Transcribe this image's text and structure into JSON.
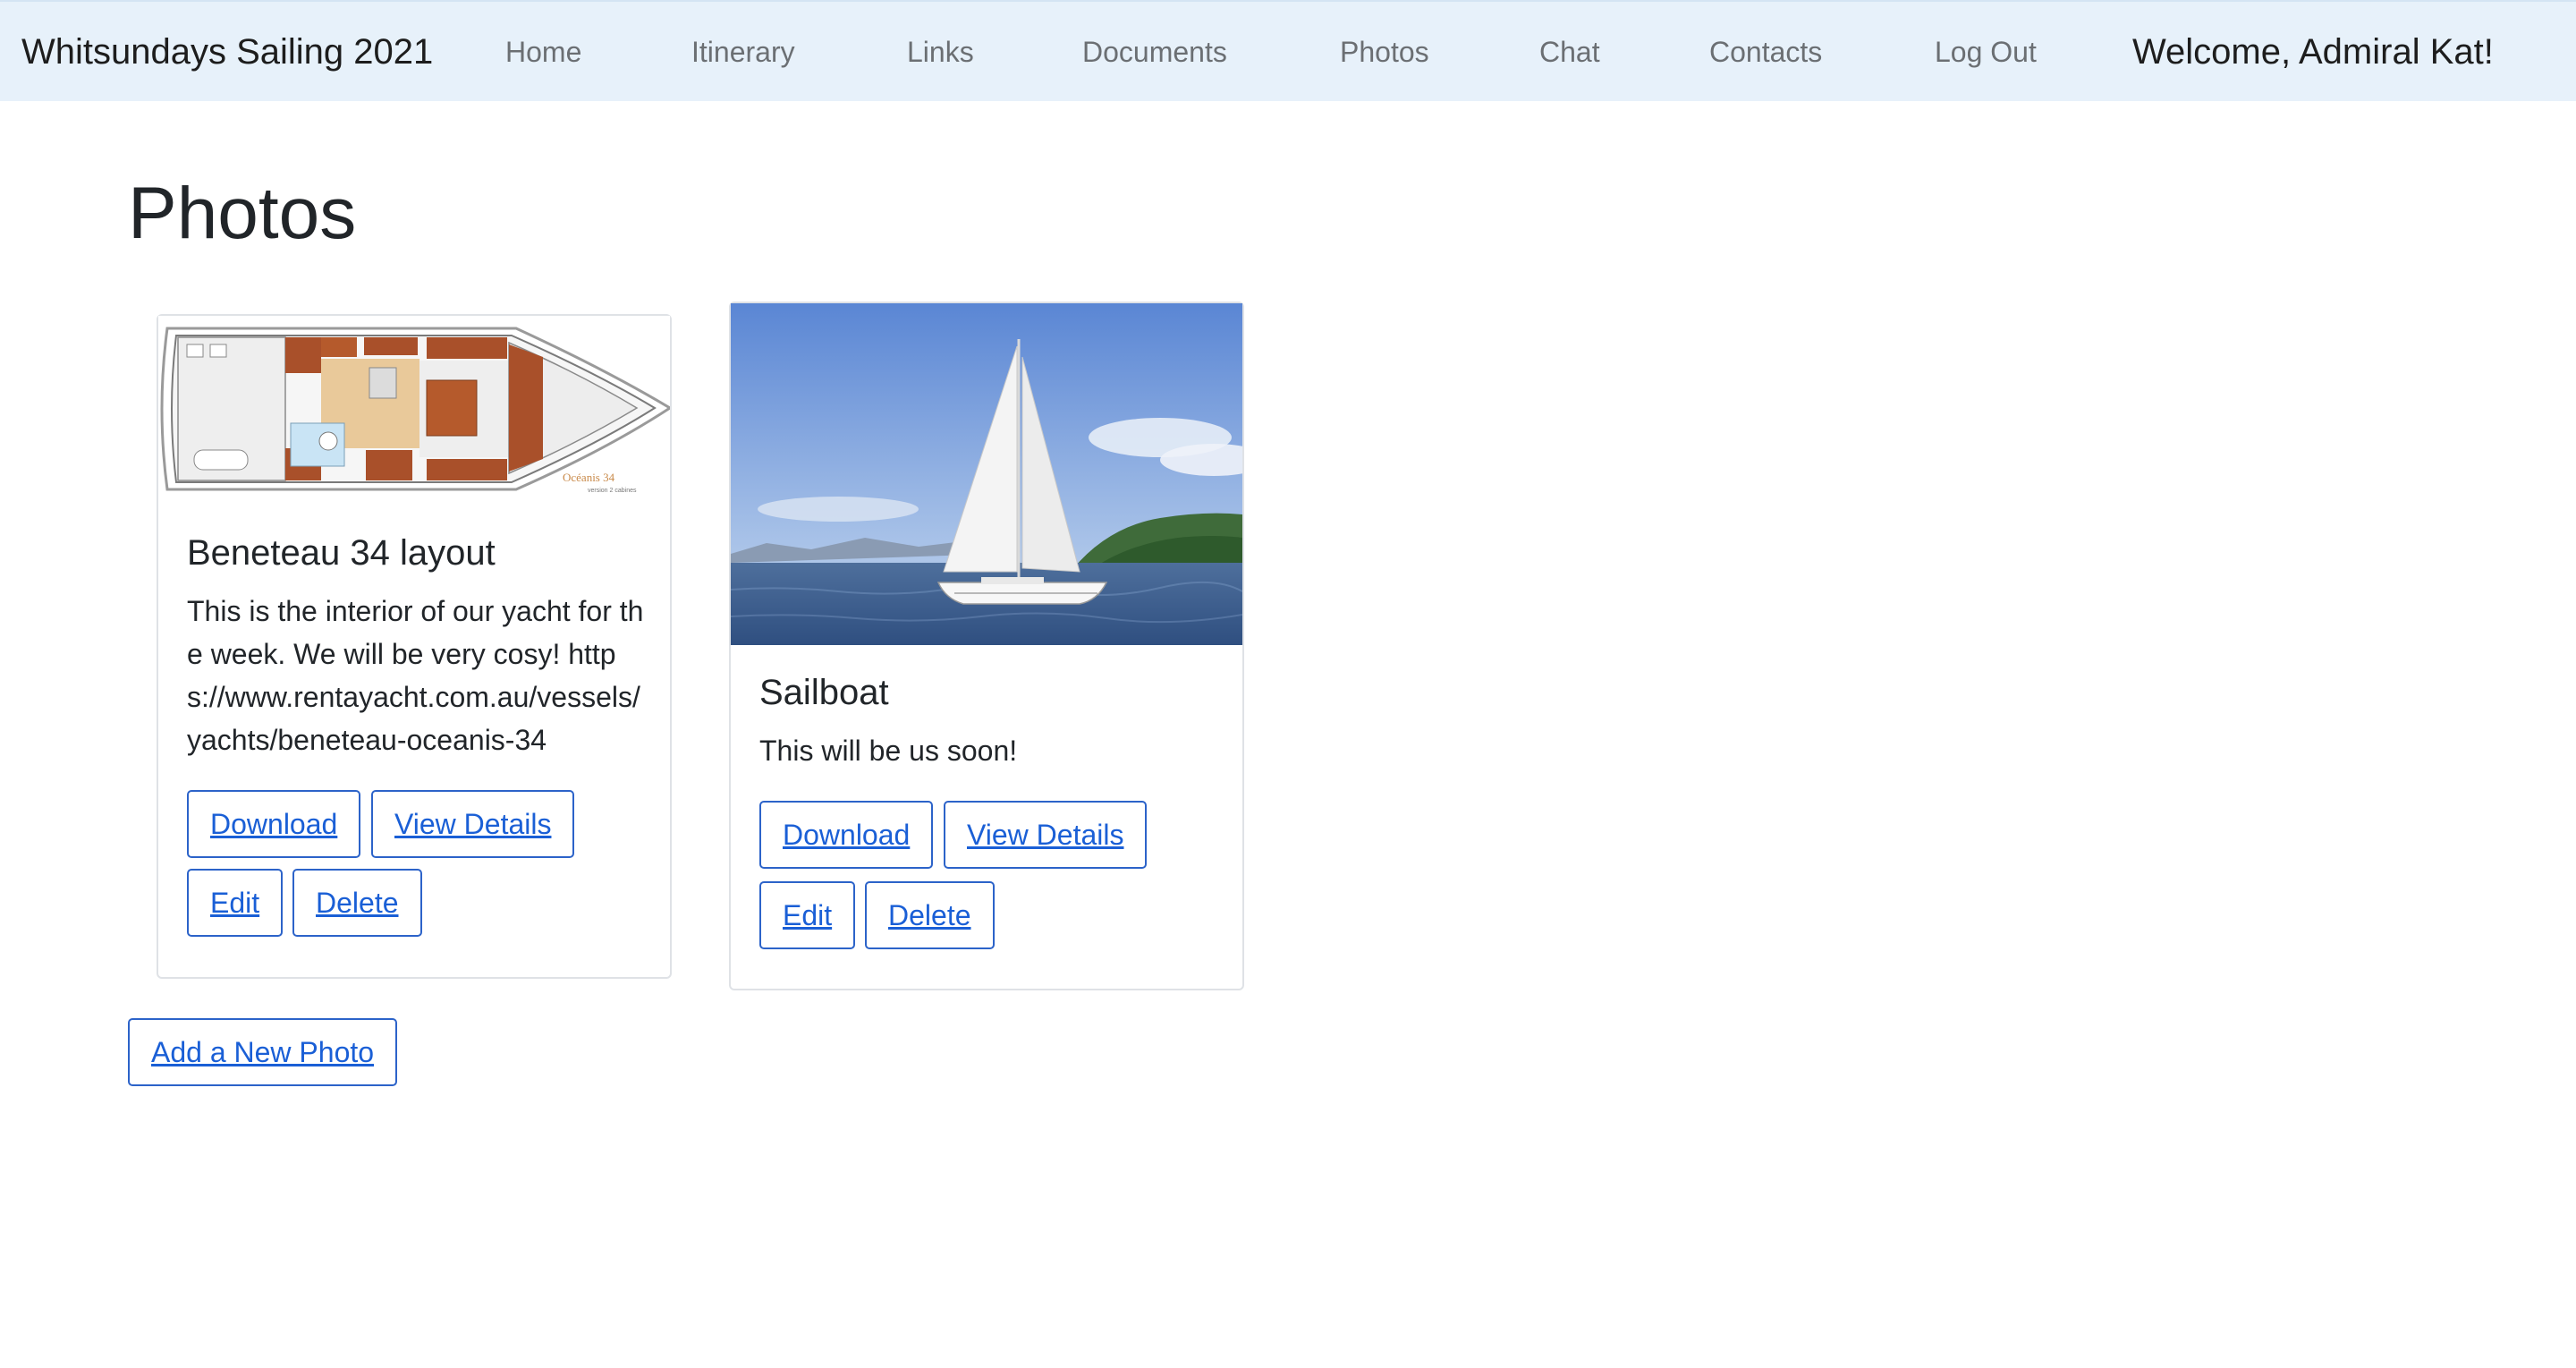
{
  "navbar": {
    "brand": "Whitsundays Sailing 2021",
    "links": [
      "Home",
      "Itinerary",
      "Links",
      "Documents",
      "Photos",
      "Chat",
      "Contacts",
      "Log Out"
    ],
    "welcome": "Welcome, Admiral Kat!"
  },
  "page": {
    "title": "Photos"
  },
  "photos": [
    {
      "title": "Beneteau 34 layout",
      "description": "This is the interior of our yacht for the week. We will be very cosy! https://www.rentayacht.com.au/vessels/yachts/beneteau-oceanis-34",
      "image_caption": "Océanis 34",
      "image_subcaption": "version 2 cabines",
      "buttons": {
        "download": "Download",
        "view_details": "View Details",
        "edit": "Edit",
        "delete": "Delete"
      }
    },
    {
      "title": "Sailboat",
      "description": "This will be us soon!",
      "buttons": {
        "download": "Download",
        "view_details": "View Details",
        "edit": "Edit",
        "delete": "Delete"
      }
    }
  ],
  "actions": {
    "add_photo": "Add a New Photo"
  },
  "colors": {
    "navbar_bg": "#e7f1fa",
    "link": "#1a5fd6",
    "button_border": "#2c63c9",
    "card_border": "#dfe2e6"
  }
}
